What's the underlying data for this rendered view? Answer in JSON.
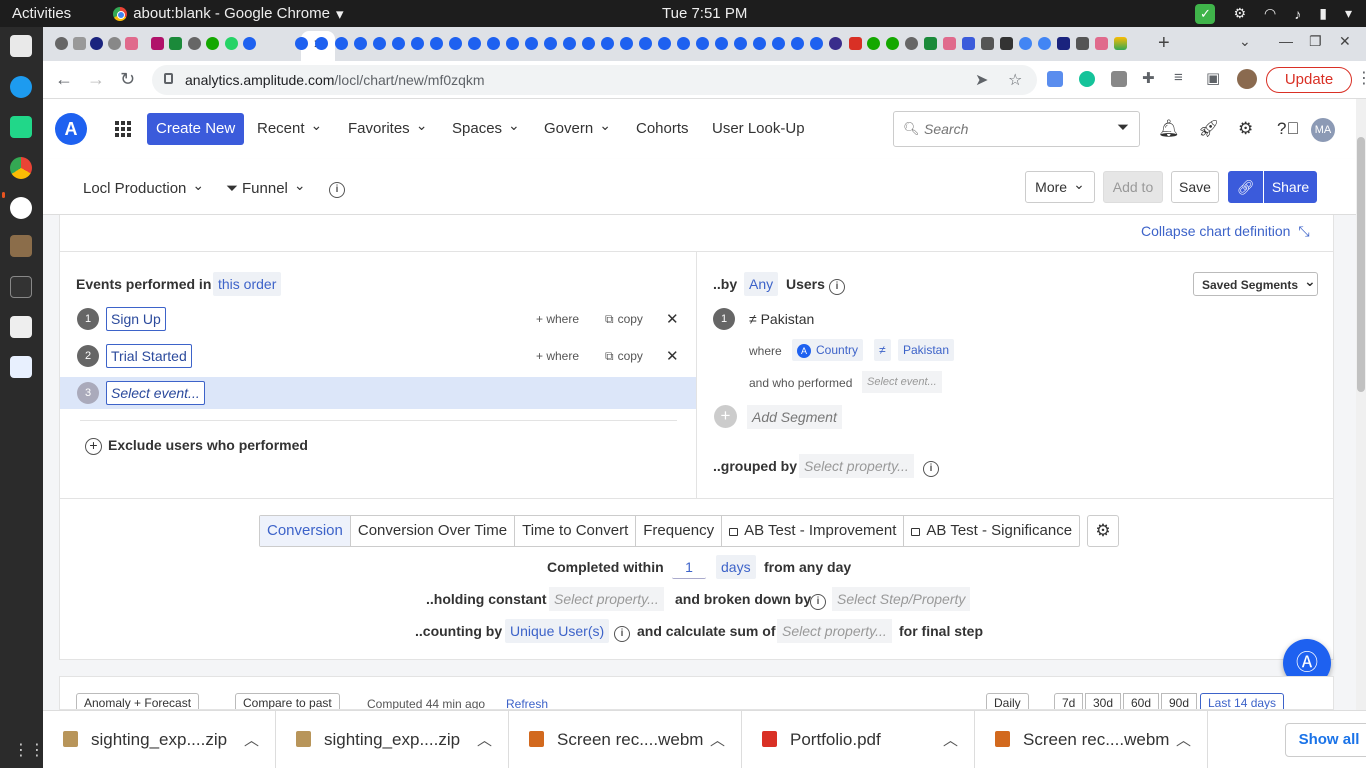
{
  "system": {
    "activities": "Activities",
    "app_title": "about:blank - Google Chrome",
    "clock": "Tue  7:51 PM"
  },
  "browser": {
    "url_host": "analytics.amplitude.com",
    "url_path": "/locl/chart/new/mf0zqkm",
    "update_label": "Update"
  },
  "app_header": {
    "create_new": "Create New",
    "nav": [
      "Recent",
      "Favorites",
      "Spaces",
      "Govern",
      "Cohorts",
      "User Look-Up"
    ],
    "search_placeholder": "Search",
    "avatar_initials": "MA"
  },
  "chart_toolbar": {
    "project": "Locl Production",
    "chart_type": "Funnel",
    "more": "More",
    "add_to": "Add to",
    "save": "Save",
    "share": "Share"
  },
  "definition": {
    "collapse_label": "Collapse chart definition",
    "events_header": "Events performed in",
    "order_chip": "this order",
    "steps": [
      {
        "num": "1",
        "event": "Sign Up",
        "where": "+ where",
        "copy": "copy"
      },
      {
        "num": "2",
        "event": "Trial Started",
        "where": "+ where",
        "copy": "copy"
      },
      {
        "num": "3",
        "event": "Select event..."
      }
    ],
    "exclude_label": "Exclude users who performed",
    "by_label": "..by",
    "any_chip": "Any",
    "users_label": "Users",
    "saved_segments": "Saved Segments",
    "segment": {
      "num": "1",
      "name": "≠ Pakistan",
      "where": "where",
      "property": "Country",
      "operator": "≠",
      "value": "Pakistan",
      "and_who_performed": "and who performed",
      "select_event": "Select event..."
    },
    "add_segment": "Add Segment",
    "grouped_by": "..grouped by",
    "select_property": "Select property..."
  },
  "funnel_options": {
    "tabs": [
      "Conversion",
      "Conversion Over Time",
      "Time to Convert",
      "Frequency",
      "AB Test - Improvement",
      "AB Test - Significance"
    ],
    "active_tab": "Conversion",
    "completed_within": "Completed within",
    "window_value": "1",
    "window_unit": "days",
    "from_any_day": "from any day",
    "holding_constant": "..holding constant",
    "holding_placeholder": "Select property...",
    "broken_down_by": "and broken down by",
    "step_property_placeholder": "Select Step/Property",
    "counting_by": "..counting by",
    "counting_value": "Unique User(s)",
    "calculate_sum": "and calculate sum of",
    "sum_placeholder": "Select property...",
    "final_step": "for final step"
  },
  "chart_bottom": {
    "anomaly": "Anomaly + Forecast",
    "compare": "Compare to past",
    "computed": "Computed 44 min ago",
    "refresh": "Refresh",
    "interval": "Daily",
    "ranges": [
      "7d",
      "30d",
      "60d",
      "90d"
    ],
    "last_range": "Last 14 days"
  },
  "downloads": {
    "items": [
      {
        "name": "sighting_exp....zip",
        "color": "#b8955a"
      },
      {
        "name": "sighting_exp....zip",
        "color": "#b8955a"
      },
      {
        "name": "Screen rec....webm",
        "color": "#d2691e"
      },
      {
        "name": "Portfolio.pdf",
        "color": "#d93025"
      },
      {
        "name": "Screen rec....webm",
        "color": "#d2691e"
      }
    ],
    "show_all": "Show all"
  }
}
